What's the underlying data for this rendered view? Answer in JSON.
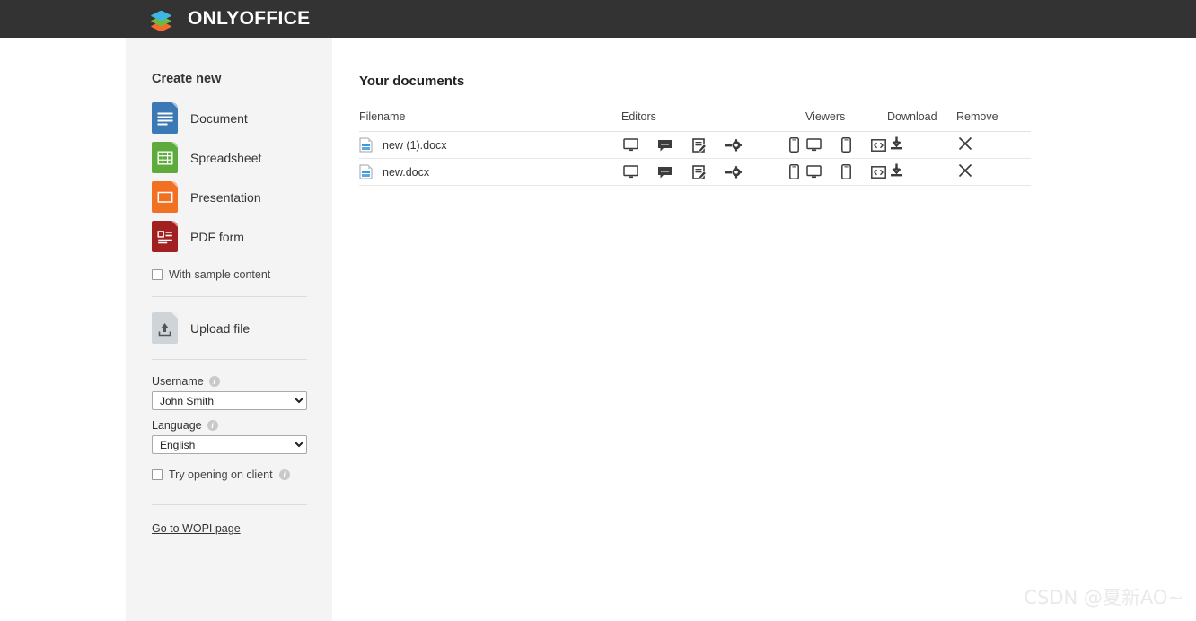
{
  "header": {
    "brand": "ONLYOFFICE",
    "logo_icon": "onlyoffice-layers-icon",
    "bg_color": "#333333"
  },
  "sidebar": {
    "title": "Create new",
    "create_items": [
      {
        "label": "Document",
        "icon": "document-file-icon",
        "color": "#3a79b6"
      },
      {
        "label": "Spreadsheet",
        "icon": "spreadsheet-file-icon",
        "color": "#5cab3c"
      },
      {
        "label": "Presentation",
        "icon": "presentation-file-icon",
        "color": "#f27022"
      },
      {
        "label": "PDF form",
        "icon": "pdf-form-file-icon",
        "color": "#a32020"
      }
    ],
    "sample_content": {
      "label": "With sample content",
      "checked": false
    },
    "upload": {
      "label": "Upload file",
      "icon": "upload-file-icon"
    },
    "username": {
      "label": "Username",
      "info_icon": "info-icon",
      "value": "John Smith",
      "options": [
        "John Smith"
      ]
    },
    "language": {
      "label": "Language",
      "info_icon": "info-icon",
      "value": "English",
      "options": [
        "English"
      ]
    },
    "try_client": {
      "label": "Try opening on client",
      "info_icon": "info-icon",
      "checked": false
    },
    "wopi_link": "Go to WOPI page"
  },
  "main": {
    "title": "Your documents",
    "columns": {
      "filename": "Filename",
      "editors": "Editors",
      "viewers": "Viewers",
      "download": "Download",
      "remove": "Remove"
    },
    "rows": [
      {
        "filename": "new (1).docx",
        "file_icon": "docx-file-icon",
        "editors": [
          "desktop-icon",
          "comment-icon",
          "edit-document-icon",
          "settings-gear-icon",
          "mobile-icon"
        ],
        "viewers": [
          "desktop-icon",
          "mobile-icon",
          "embed-code-icon"
        ],
        "download": "download-icon",
        "remove": "close-x-icon"
      },
      {
        "filename": "new.docx",
        "file_icon": "docx-file-icon",
        "editors": [
          "desktop-icon",
          "comment-icon",
          "edit-document-icon",
          "settings-gear-icon",
          "mobile-icon"
        ],
        "viewers": [
          "desktop-icon",
          "mobile-icon",
          "embed-code-icon"
        ],
        "download": "download-icon",
        "remove": "close-x-icon"
      }
    ]
  },
  "watermark": "CSDN @夏新AO~"
}
